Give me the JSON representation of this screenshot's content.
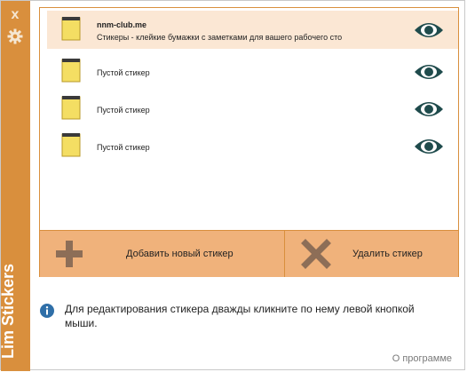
{
  "app": {
    "title": "Lim Stickers",
    "close_glyph": "x"
  },
  "notes": [
    {
      "title": "nnm-club.me",
      "subtitle": "Стикеры - клейкие бумажки с заметками для вашего рабочего сто",
      "selected": true
    },
    {
      "title": "",
      "subtitle": "Пустой стикер",
      "selected": false
    },
    {
      "title": "",
      "subtitle": "Пустой стикер",
      "selected": false
    },
    {
      "title": "",
      "subtitle": "Пустой стикер",
      "selected": false
    }
  ],
  "toolbar": {
    "add_label": "Добавить новый стикер",
    "delete_label": "Удалить стикер"
  },
  "info": {
    "text": "Для редактирования стикера дважды кликните по нему левой кнопкой мыши."
  },
  "footer": {
    "about_label": "О программе"
  },
  "colors": {
    "accent": "#d98f3d",
    "button_bg": "#f0b27b",
    "selected_row": "#fbe7d4",
    "note_yellow": "#f4de63",
    "eye": "#1f4b4c"
  }
}
